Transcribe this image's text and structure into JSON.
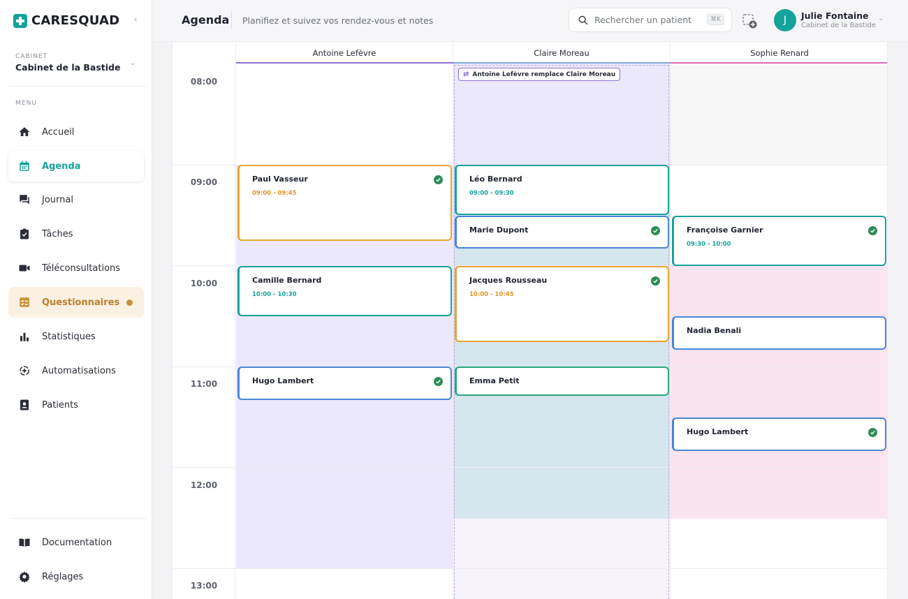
{
  "app": {
    "name": "CARESQUAD"
  },
  "sidebar": {
    "cabinet_label": "CABINET",
    "cabinet_name": "Cabinet de la Bastide",
    "menu_label": "MENU",
    "items": [
      {
        "label": "Accueil",
        "icon": "home-icon"
      },
      {
        "label": "Agenda",
        "icon": "calendar-icon",
        "state": "active"
      },
      {
        "label": "Journal",
        "icon": "chat-icon"
      },
      {
        "label": "Tâches",
        "icon": "clipboard-check-icon"
      },
      {
        "label": "Téléconsultations",
        "icon": "video-icon"
      },
      {
        "label": "Questionnaires",
        "icon": "checklist-icon",
        "state": "highlight",
        "badge": "dot"
      },
      {
        "label": "Statistiques",
        "icon": "bar-chart-icon"
      },
      {
        "label": "Automatisations",
        "icon": "automation-icon"
      },
      {
        "label": "Patients",
        "icon": "contact-card-icon"
      }
    ],
    "footer_items": [
      {
        "label": "Documentation",
        "icon": "book-icon"
      },
      {
        "label": "Réglages",
        "icon": "gear-icon"
      }
    ]
  },
  "header": {
    "title": "Agenda",
    "subtitle": "Planifiez et suivez vos rendez-vous et notes",
    "search_placeholder": "Rechercher un patient",
    "search_shortcut": "⌘K",
    "user_initial": "J",
    "user_name": "Julie Fontaine",
    "user_cabinet": "Cabinet de la Bastide"
  },
  "calendar": {
    "hours": [
      "08:00",
      "09:00",
      "10:00",
      "11:00",
      "12:00",
      "13:00"
    ],
    "practitioners": [
      {
        "name": "Antoine Lefèvre",
        "accent": "#8b6fd6"
      },
      {
        "name": "Claire Moreau",
        "accent": "#7ea7d8"
      },
      {
        "name": "Sophie Renard",
        "accent": "#d86ab4"
      }
    ],
    "replacement_note": "Antoine Lefèvre remplace Claire Moreau",
    "appointments": {
      "paul_vasseur": {
        "patient": "Paul Vasseur",
        "time": "09:00 - 09:45",
        "confirmed": true,
        "color": "#e8a531"
      },
      "camille_bernard": {
        "patient": "Camille Bernard",
        "time": "10:00 - 10:30",
        "confirmed": false,
        "color": "#17a39a"
      },
      "hugo_lambert_1": {
        "patient": "Hugo Lambert",
        "time": "",
        "confirmed": true,
        "color": "#4a86d6"
      },
      "leo_bernard": {
        "patient": "Léo Bernard",
        "time": "09:00 - 09:30",
        "confirmed": false,
        "color": "#17a39a"
      },
      "marie_dupont": {
        "patient": "Marie Dupont",
        "time": "",
        "confirmed": true,
        "color": "#4a86d6"
      },
      "jacques_rousseau": {
        "patient": "Jacques Rousseau",
        "time": "10:00 - 10:45",
        "confirmed": true,
        "color": "#e8a531"
      },
      "emma_petit": {
        "patient": "Emma Petit",
        "time": "",
        "confirmed": false,
        "color": "#2aa77a"
      },
      "francoise_garnier": {
        "patient": "Françoise Garnier",
        "time": "09:30 - 10:00",
        "confirmed": true,
        "color": "#17a39a"
      },
      "nadia_benali": {
        "patient": "Nadia Benali",
        "time": "",
        "confirmed": false,
        "color": "#4a86d6"
      },
      "hugo_lambert_2": {
        "patient": "Hugo Lambert",
        "time": "",
        "confirmed": true,
        "color": "#4a86d6"
      }
    }
  }
}
